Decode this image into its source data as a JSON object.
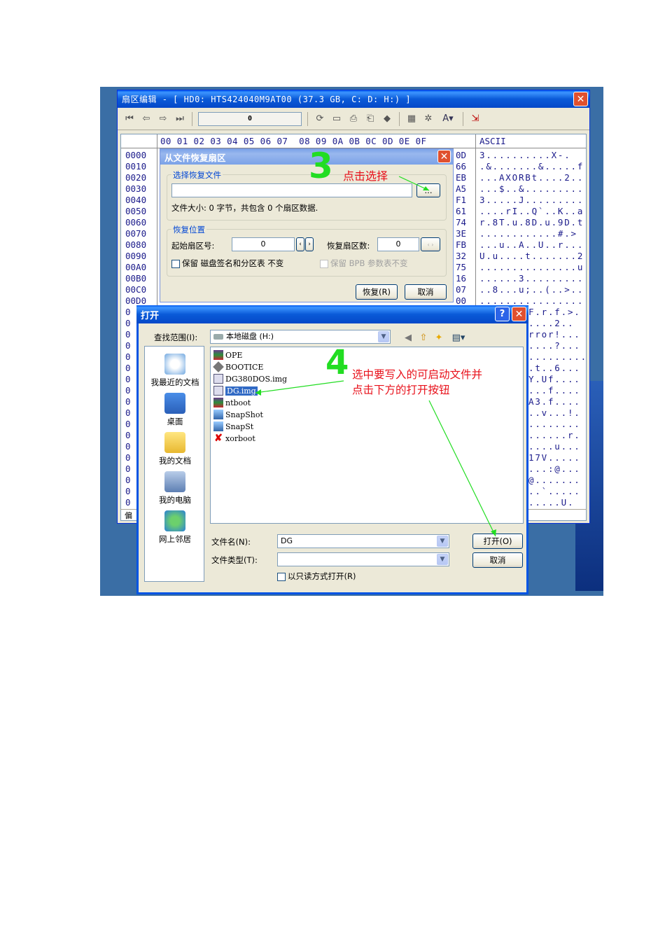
{
  "sector_editor": {
    "title": "扇区编辑 - [ HD0: HTS424040M9AT00 (37.3 GB, C: D: H:) ]",
    "sector_value": "0",
    "hex_header": "00 01 02 03 04 05 06 07  08 09 0A 0B 0C 0D 0E 0F",
    "ascii_header": "ASCII",
    "offsets": [
      "0000",
      "0010",
      "0020",
      "0030",
      "0040",
      "0050",
      "0060",
      "0070",
      "0080",
      "0090",
      "00A0",
      "00B0",
      "00C0",
      "00D0"
    ],
    "left_zero_rows": [
      "0",
      "0",
      "0",
      "0",
      "0",
      "0",
      "0",
      "0",
      "0",
      "0",
      "0",
      "0",
      "0",
      "0",
      "0",
      "0",
      "0",
      "0"
    ],
    "hex_right_col": [
      "0D",
      "66",
      "EB",
      "A5",
      "F1",
      "61",
      "74",
      "3E",
      "FB",
      "32",
      "75",
      "16",
      "07",
      "00"
    ],
    "ascii_rows": [
      "3..........X-.",
      ".&.......&.....f",
      "...AXORBt....2..",
      "...$..&.........",
      "3.....J.........",
      "....rI..Q`..K..a",
      "r.8T.u.8D.u.9D.t",
      "............#.>",
      "...u..A..U..r...",
      "U.u....t.......2",
      "...............u",
      "......3.........",
      "..8...u;..(..>..",
      "................"
    ],
    "ascii_rows_lower": [
      "F.r.f.>.",
      "....2..",
      "rror!...",
      "....?...",
      ".........",
      ".t..6...",
      "Y.Uf....",
      "...f....",
      "A3.f....",
      "..v...!.",
      "........",
      "......r.",
      "....u...",
      "17V.....",
      "...:@...",
      "@.......",
      "..`.....",
      ".....U."
    ],
    "status_text": "偏"
  },
  "restore_dialog": {
    "title": "从文件恢复扇区",
    "group_file": "选择恢复文件",
    "file_path": "",
    "browse_label": "...",
    "file_info": "文件大小: 0 字节，共包含 0 个扇区数据.",
    "group_position": "恢复位置",
    "start_sector_label": "起始扇区号:",
    "start_sector_value": "0",
    "sector_count_label": "恢复扇区数:",
    "sector_count_value": "0",
    "keep_sig_label": "保留 磁盘签名和分区表 不变",
    "keep_bpb_label": "保留 BPB 参数表不变",
    "restore_button": "恢复(R)",
    "cancel_button": "取消"
  },
  "open_dialog": {
    "title": "打开",
    "look_in_label": "查找范围(I):",
    "look_in_value": "本地磁盘 (H:)",
    "places": [
      "我最近的文档",
      "桌面",
      "我的文档",
      "我的电脑",
      "网上邻居"
    ],
    "files": [
      "OPE",
      "BOOTICE",
      "DG380DOS.img",
      "DG.img",
      "ntboot",
      "SnapShot",
      "SnapSt",
      "xorboot"
    ],
    "selected_file": "DG.img",
    "filename_label": "文件名(N):",
    "filename_value": "DG",
    "filetype_label": "文件类型(T):",
    "filetype_value": "",
    "readonly_label": "以只读方式打开(R)",
    "open_button": "打开(O)",
    "cancel_button": "取消"
  },
  "annotations": {
    "step3_number": "3",
    "step3_text": "点击选择",
    "step4_number": "4",
    "step4_text_line1": "选中要写入的可启动文件并",
    "step4_text_line2": "点击下方的打开按钮"
  },
  "colors": {
    "titlebar_blue": "#0a5ad8",
    "annotation_red": "#e8101a",
    "annotation_green": "#22dd22",
    "selection": "#316ac5"
  }
}
